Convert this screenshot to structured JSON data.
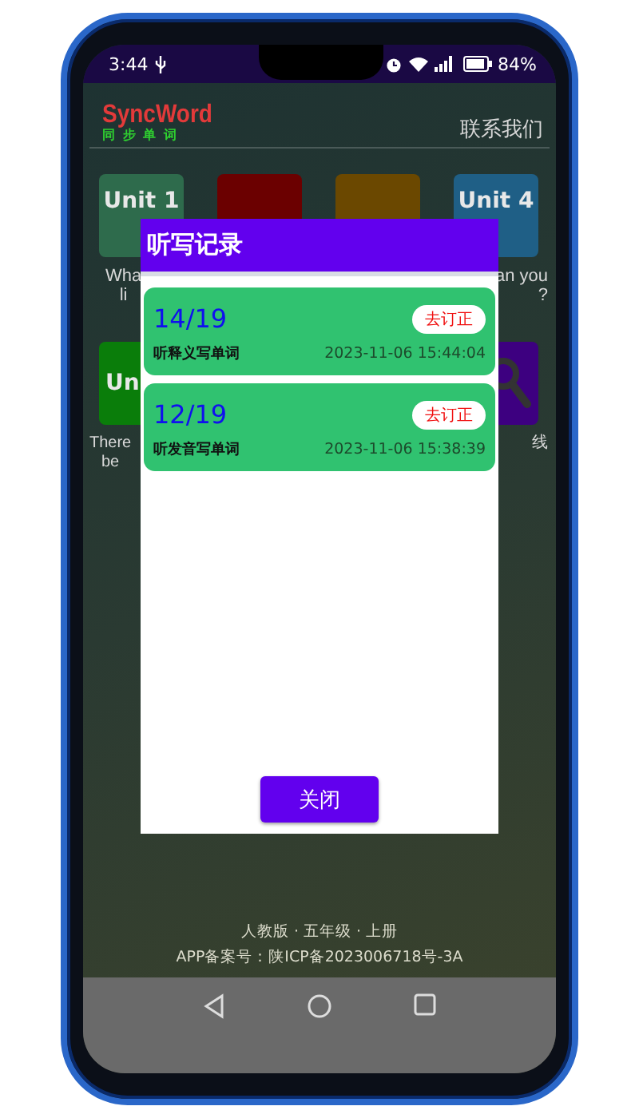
{
  "status_bar": {
    "time": "3:44",
    "battery": "84%"
  },
  "header": {
    "logo": "SyncWord",
    "logo_subtitle": "同 步 单 词",
    "contact_link": "联系我们"
  },
  "tiles_row_1": [
    {
      "label": "Unit 1",
      "color": "#2e6b4c"
    },
    {
      "color": "#6b0000"
    },
    {
      "color": "#6b4800"
    },
    {
      "label": "Unit 4",
      "color": "#1f5f86"
    }
  ],
  "captions_row_1": {
    "left": [
      "Wha",
      "li"
    ],
    "right": [
      "an you",
      "?"
    ]
  },
  "tiles_row_2": [
    {
      "kind": "label",
      "label": "Un",
      "color": "#0a7d0a"
    },
    {
      "kind": "search",
      "color": "#3d0080"
    }
  ],
  "captions_row_2": {
    "left": [
      "There",
      "be"
    ],
    "right": [
      "线"
    ]
  },
  "dialog": {
    "title": "听写记录",
    "records": [
      {
        "score": "14/19",
        "action": "去订正",
        "type": "听释义写单词",
        "time": "2023-11-06 15:44:04"
      },
      {
        "score": "12/19",
        "action": "去订正",
        "type": "听发音写单词",
        "time": "2023-11-06 15:38:39"
      }
    ],
    "close_button": "关闭"
  },
  "footer": [
    "人教版 · 五年级 · 上册",
    "APP备案号：陕ICP备2023006718号-3A"
  ]
}
